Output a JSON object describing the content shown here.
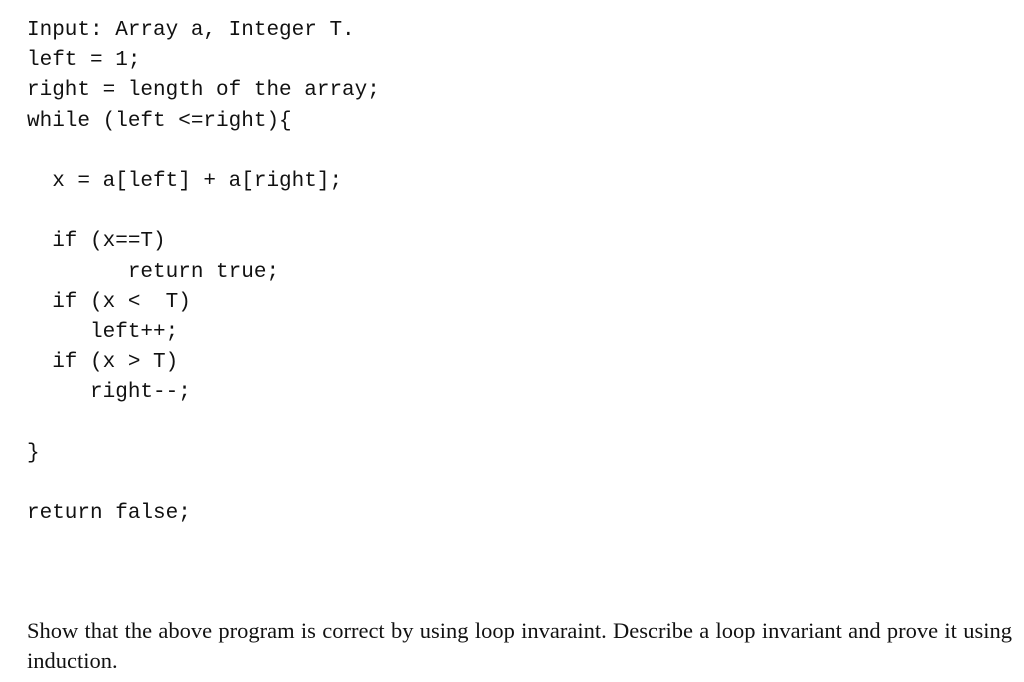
{
  "code": {
    "lines": [
      "Input: Array a, Integer T.",
      "left = 1;",
      "right = length of the array;",
      "while (left <=right){",
      "",
      "  x = a[left] + a[right];",
      "",
      "  if (x==T)",
      "        return true;",
      "  if (x <  T)",
      "     left++;",
      "  if (x > T)",
      "     right--;",
      "",
      "}",
      "",
      "return false;"
    ]
  },
  "question": {
    "text": "Show that the above program is correct by using loop invaraint. Describe a loop invariant and prove it using induction."
  }
}
